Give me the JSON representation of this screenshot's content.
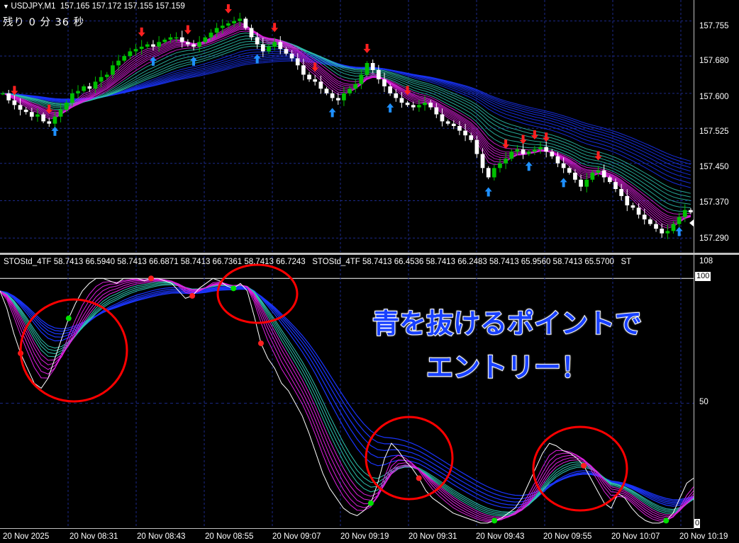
{
  "symbol_header": {
    "symbol": "USDJPY,M1",
    "ohlc": "157.165 157.172 157.155 157.159"
  },
  "countdown": "残り 0 分 36 秒",
  "price_axis": [
    "157.755",
    "157.680",
    "157.600",
    "157.525",
    "157.450",
    "157.370",
    "157.290"
  ],
  "osc_header": "STOStd_4TF 58.7413 66.5940 58.7413 66.6871 58.7413 66.7361 58.7413 66.7243   STOStd_4TF 58.7413 66.4536 58.7413 66.2483 58.7413 65.9560 58.7413 65.5700   ST",
  "osc_axis": {
    "top": "108",
    "hundred": "100",
    "fifty": "50",
    "zero": "0"
  },
  "time_axis": [
    "20 Nov 2025",
    "20 Nov 08:31",
    "20 Nov 08:43",
    "20 Nov 08:55",
    "20 Nov 09:07",
    "20 Nov 09:19",
    "20 Nov 09:31",
    "20 Nov 09:43",
    "20 Nov 09:55",
    "20 Nov 10:07",
    "20 Nov 10:19"
  ],
  "callout": {
    "line1": "青を抜けるポイントで",
    "line2": "エントリー！"
  },
  "colors": {
    "bull": "#00c000",
    "bear": "#ffffff",
    "ema_blue": "#1a35ff",
    "ema_teal": "#2ec4b0",
    "ema_magenta": "#e020e0",
    "arrow_up": "#1e90ff",
    "arrow_down": "#ff2020",
    "circle": "#ff0000",
    "grid": "#1c2a8a"
  },
  "chart_data": [
    {
      "type": "candlestick",
      "title": "USDJPY,M1",
      "ylim": [
        157.26,
        157.8
      ],
      "price_path": [
        157.6,
        157.585,
        157.575,
        157.565,
        157.56,
        157.55,
        157.555,
        157.54,
        157.535,
        157.55,
        157.565,
        157.58,
        157.6,
        157.605,
        157.615,
        157.61,
        157.625,
        157.635,
        157.64,
        157.66,
        157.67,
        157.68,
        157.69,
        157.695,
        157.7,
        157.705,
        157.7,
        157.71,
        157.715,
        157.72,
        157.72,
        157.71,
        157.705,
        157.7,
        157.71,
        157.72,
        157.73,
        157.74,
        157.745,
        157.75,
        157.755,
        157.76,
        157.74,
        157.72,
        157.705,
        157.69,
        157.7,
        157.71,
        157.695,
        157.685,
        157.675,
        157.66,
        157.64,
        157.63,
        157.625,
        157.61,
        157.6,
        157.59,
        157.585,
        157.6,
        157.61,
        157.62,
        157.64,
        157.665,
        157.65,
        157.63,
        157.615,
        157.6,
        157.59,
        157.58,
        157.575,
        157.57,
        157.575,
        157.58,
        157.57,
        157.555,
        157.54,
        157.535,
        157.53,
        157.52,
        157.51,
        157.5,
        157.47,
        157.44,
        157.42,
        157.44,
        157.45,
        157.46,
        157.475,
        157.48,
        157.47,
        157.475,
        157.48,
        157.485,
        157.475,
        157.465,
        157.45,
        157.44,
        157.43,
        157.415,
        157.4,
        157.415,
        157.43,
        157.435,
        157.42,
        157.41,
        157.395,
        157.38,
        157.36,
        157.355,
        157.34,
        157.33,
        157.32,
        157.31,
        157.3,
        157.305,
        157.32,
        157.335,
        157.35,
        157.345
      ]
    },
    {
      "type": "line",
      "title": "STOStd_4TF",
      "ylim": [
        0,
        108
      ],
      "stoch_path": [
        95,
        88,
        78,
        70,
        64,
        58,
        56,
        60,
        68,
        76,
        84,
        90,
        95,
        98,
        100,
        100,
        99,
        98,
        100,
        100,
        100,
        99,
        100,
        100,
        99,
        98,
        95,
        92,
        93,
        96,
        98,
        100,
        99,
        97,
        96,
        98,
        95,
        85,
        74,
        68,
        64,
        58,
        55,
        50,
        45,
        38,
        30,
        22,
        16,
        12,
        8,
        6,
        5,
        7,
        10,
        18,
        28,
        34,
        31,
        27,
        24,
        20,
        15,
        12,
        10,
        8,
        6,
        5,
        4,
        3,
        2,
        2,
        3,
        4,
        6,
        8,
        12,
        18,
        24,
        30,
        34,
        33,
        31,
        30,
        28,
        25,
        20,
        15,
        10,
        8,
        14,
        12,
        8,
        5,
        3,
        2,
        2,
        3,
        6,
        12,
        18,
        20
      ]
    }
  ]
}
